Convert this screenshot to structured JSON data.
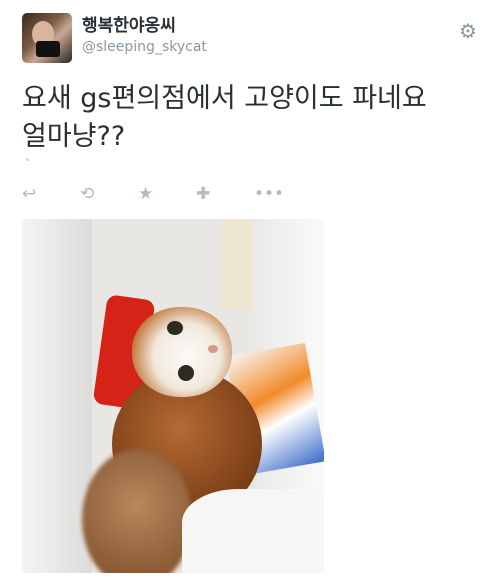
{
  "user": {
    "display_name": "행복한야옹씨",
    "handle": "@sleeping_skycat"
  },
  "tweet": {
    "text_line1": "요새 gs편의점에서 고양이도 파네요",
    "text_line2": "얼마냥??"
  },
  "icons": {
    "settings": "gear-icon",
    "reply": "reply-icon",
    "retweet": "retweet-icon",
    "favorite": "star-icon",
    "follow": "follow-icon",
    "more": "more-icon"
  },
  "colors": {
    "text": "#292f33",
    "muted": "#8899a6",
    "action_icon": "#b1bbc3"
  }
}
